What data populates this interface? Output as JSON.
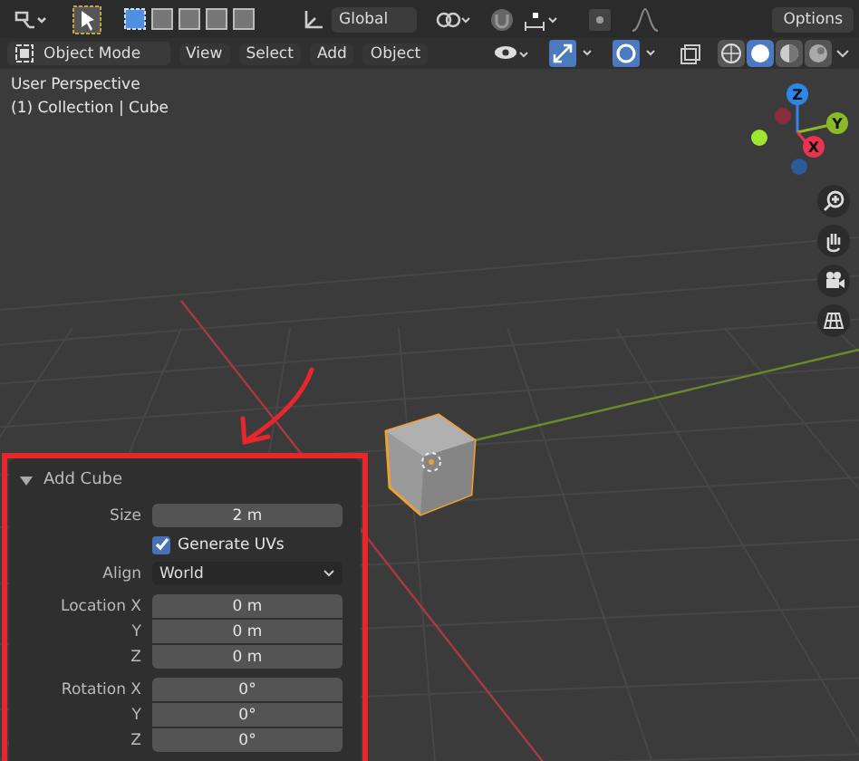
{
  "toolbar": {
    "selection_modes": [
      {
        "selected": true
      },
      {
        "selected": false
      },
      {
        "selected": false
      },
      {
        "selected": false
      },
      {
        "selected": false
      }
    ],
    "transform_orientation": "Global",
    "options": "Options"
  },
  "header": {
    "mode": "Object Mode",
    "menus": [
      "View",
      "Select",
      "Add",
      "Object"
    ],
    "shading_modes": [
      {
        "selected": false
      },
      {
        "selected": true
      },
      {
        "selected": false
      },
      {
        "selected": false
      }
    ]
  },
  "viewport": {
    "view_name": "User Perspective",
    "context": "(1) Collection | Cube",
    "gizmo_axes": [
      "X",
      "Y",
      "Z"
    ]
  },
  "operator_panel": {
    "title": "Add Cube",
    "expanded": true,
    "rows": [
      {
        "kind": "number",
        "label": "Size",
        "value": "2 m"
      },
      {
        "kind": "checkbox",
        "label": "Generate UVs",
        "checked": true
      },
      {
        "kind": "dropdown",
        "label": "Align",
        "value": "World"
      },
      {
        "kind": "vector",
        "components": [
          {
            "label": "Location X",
            "value": "0 m"
          },
          {
            "label": "Y",
            "value": "0 m"
          },
          {
            "label": "Z",
            "value": "0 m"
          }
        ]
      },
      {
        "kind": "vector",
        "components": [
          {
            "label": "Rotation X",
            "value": "0°"
          },
          {
            "label": "Y",
            "value": "0°"
          },
          {
            "label": "Z",
            "value": "0°"
          }
        ]
      }
    ]
  }
}
